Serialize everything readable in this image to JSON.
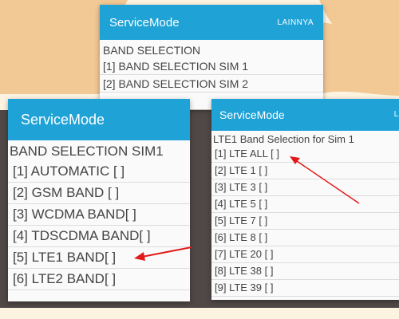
{
  "colors": {
    "appbar": "#1fa2d6",
    "background_cream": "#fdf3e1",
    "background_blob": "#f2c895",
    "dark_bar": "#504846",
    "arrow": "#e11b1b"
  },
  "top_panel": {
    "title": "ServiceMode",
    "action": "LAINNYA",
    "header": "BAND SELECTION",
    "items": [
      "[1] BAND SELECTION SIM 1",
      "[2] BAND SELECTION SIM 2"
    ]
  },
  "left_panel": {
    "title": "ServiceMode",
    "header": "BAND SELECTION SIM1",
    "items": [
      "[1] AUTOMATIC [ ]",
      "[2] GSM BAND  [ ]",
      "[3] WCDMA BAND[ ]",
      "[4] TDSCDMA BAND[ ]",
      "[5] LTE1 BAND[ ]",
      "[6] LTE2 BAND[ ]"
    ]
  },
  "right_panel": {
    "title": "ServiceMode",
    "action": "LA",
    "header": "LTE1 Band Selection for Sim 1",
    "items": [
      "[1] LTE ALL [ ]",
      "[2] LTE 1 [ ]",
      "[3] LTE 3 [ ]",
      "[4] LTE 5 [ ]",
      "[5] LTE 7 [ ]",
      "[6] LTE 8 [ ]",
      "[7] LTE 20 [ ]",
      "[8] LTE 38 [ ]",
      "[9] LTE 39 [ ]"
    ]
  }
}
